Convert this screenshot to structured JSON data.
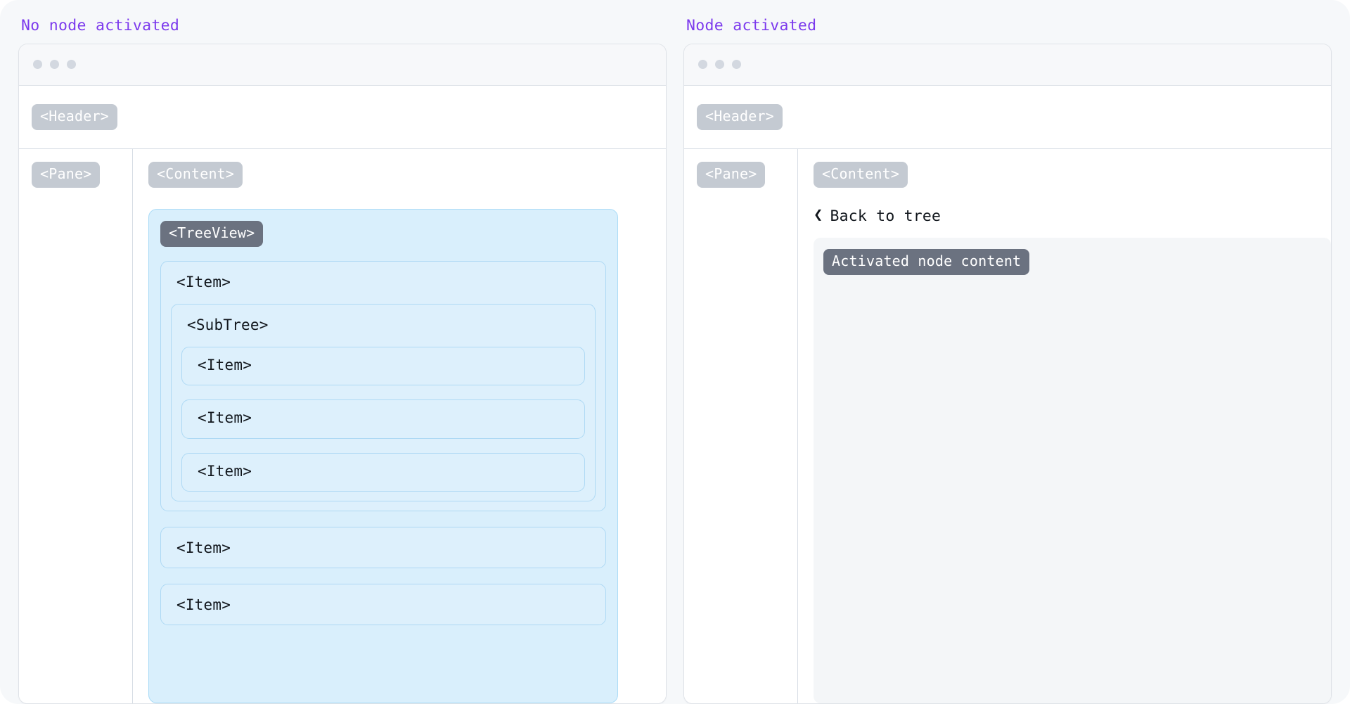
{
  "theme": {
    "page_bg": "#f6f8fa",
    "title_color": "#7c3aed",
    "card_bg": "#ffffff",
    "card_border": "#dfe3e8",
    "tag_bg": "#c4cad2",
    "tag_dark_bg": "#6b7280",
    "tree_bg": "#d9effc",
    "tree_border": "#abdcf7",
    "node_bg": "#ddf0fc",
    "node_border": "#aed9f4",
    "activated_panel_bg": "#f4f6f8",
    "dot_color": "#d3d8e0"
  },
  "panels": [
    {
      "title": "No node activated",
      "chrome": {
        "dots": [
          "dot-red",
          "dot-yellow",
          "dot-green"
        ]
      },
      "header_tag": "<Header>",
      "pane_tag": "<Pane>",
      "content_tag": "<Content>",
      "tree": {
        "label": "<TreeView>",
        "children": [
          {
            "label": "<Item>",
            "subtree": {
              "label": "<SubTree>",
              "children": [
                {
                  "label": "<Item>"
                },
                {
                  "label": "<Item>"
                },
                {
                  "label": "<Item>"
                }
              ]
            }
          },
          {
            "label": "<Item>"
          },
          {
            "label": "<Item>"
          }
        ]
      }
    },
    {
      "title": "Node activated",
      "chrome": {
        "dots": [
          "dot-red",
          "dot-yellow",
          "dot-green"
        ]
      },
      "header_tag": "<Header>",
      "pane_tag": "<Pane>",
      "content_tag": "<Content>",
      "back_link": {
        "icon": "chevron-left-icon",
        "glyph": "❮",
        "label": "Back to tree"
      },
      "activated_tag": "Activated node content"
    }
  ]
}
